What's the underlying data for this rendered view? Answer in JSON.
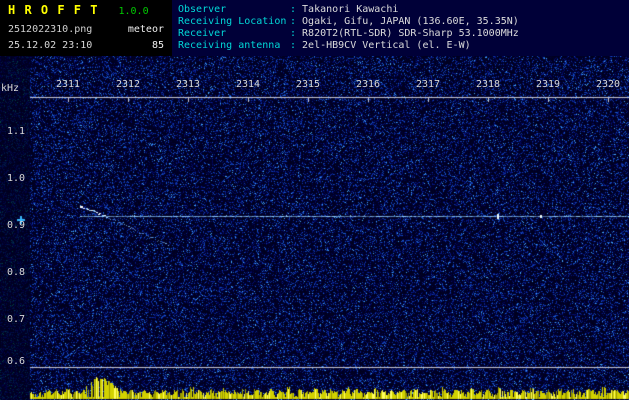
{
  "app": {
    "title": "H R O F F T",
    "version": "1.0.0",
    "filename": "2512022310.png",
    "mode": "meteor",
    "datetime": "25.12.02 23:10",
    "count": "85"
  },
  "info": {
    "separator": ":",
    "rows": [
      {
        "label": "Observer",
        "value": "Takanori Kawachi"
      },
      {
        "label": "Receiving Location",
        "value": "Ogaki, Gifu, JAPAN (136.60E, 35.35N)"
      },
      {
        "label": "Receiver",
        "value": "R820T2(RTL-SDR) SDR-Sharp 53.1000MHz"
      },
      {
        "label": "Receiving antenna",
        "value": "2el-HB9CV Vertical (el. E-W)"
      }
    ]
  },
  "colors": {
    "title_yellow": "#ffff00",
    "version_green": "#00cc00",
    "label_cyan": "#00d8d8",
    "value_white": "#dcdcdc",
    "header_navy": "#000038",
    "carrier_blue": "#96d2ff",
    "histogram_yellow": "#d2d200",
    "marker_cyan": "#38b8ff"
  },
  "chart_data": {
    "type": "heatmap",
    "title": "",
    "x_ticks": [
      "2311",
      "2312",
      "2313",
      "2314",
      "2315",
      "2316",
      "2317",
      "2318",
      "2319",
      "2320"
    ],
    "y_unit": "kHz",
    "y_ticks": [
      "1.1",
      "1.0",
      "0.9",
      "0.8",
      "0.7",
      "0.6"
    ],
    "y_range_khz": [
      0.58,
      1.17
    ],
    "carrier": {
      "freq_khz": 0.92,
      "start_min": 1.2,
      "pings": [
        {
          "t_min": 8.15,
          "h": 5
        },
        {
          "t_min": 8.87,
          "h": 3
        }
      ]
    },
    "trace": {
      "points_min_khz": [
        [
          1.2,
          0.94
        ],
        [
          1.45,
          0.928
        ],
        [
          1.7,
          0.914
        ],
        [
          1.95,
          0.9
        ],
        [
          2.2,
          0.884
        ],
        [
          2.45,
          0.87
        ],
        [
          2.67,
          0.858
        ]
      ]
    },
    "marker_freq_khz": 0.92,
    "histogram": {
      "color": "#d2d200",
      "values": [
        6,
        4,
        7,
        5,
        8,
        6,
        9,
        5,
        7,
        10,
        6,
        8,
        5,
        9,
        13,
        17,
        21,
        22,
        20,
        18,
        15,
        12,
        9,
        7,
        6,
        8,
        5,
        7,
        9,
        6,
        5,
        8,
        6,
        10,
        7,
        5,
        8,
        6,
        9,
        7,
        11,
        6,
        8,
        5,
        7,
        9,
        6,
        8,
        10,
        7,
        5,
        8,
        6,
        9,
        7,
        5,
        10,
        8,
        6,
        7,
        9,
        5,
        8,
        6,
        11,
        7,
        5,
        9,
        6,
        8,
        7,
        10,
        5,
        8,
        6,
        9,
        7,
        5,
        8,
        11,
        6,
        9,
        7,
        5,
        8,
        6,
        10,
        7,
        9,
        5,
        8,
        6,
        7,
        9,
        5,
        8,
        10,
        6,
        7,
        5,
        9,
        8,
        6,
        11,
        7,
        5,
        8,
        9,
        6,
        7,
        10,
        5,
        8,
        6,
        9,
        7,
        5,
        11,
        8,
        6,
        9,
        7,
        5,
        8,
        6,
        10,
        7,
        9,
        5,
        8,
        6,
        7,
        9,
        5,
        8,
        10,
        6,
        7,
        5,
        9,
        8,
        6,
        7,
        11,
        5,
        8,
        9,
        6,
        7,
        8
      ]
    }
  }
}
